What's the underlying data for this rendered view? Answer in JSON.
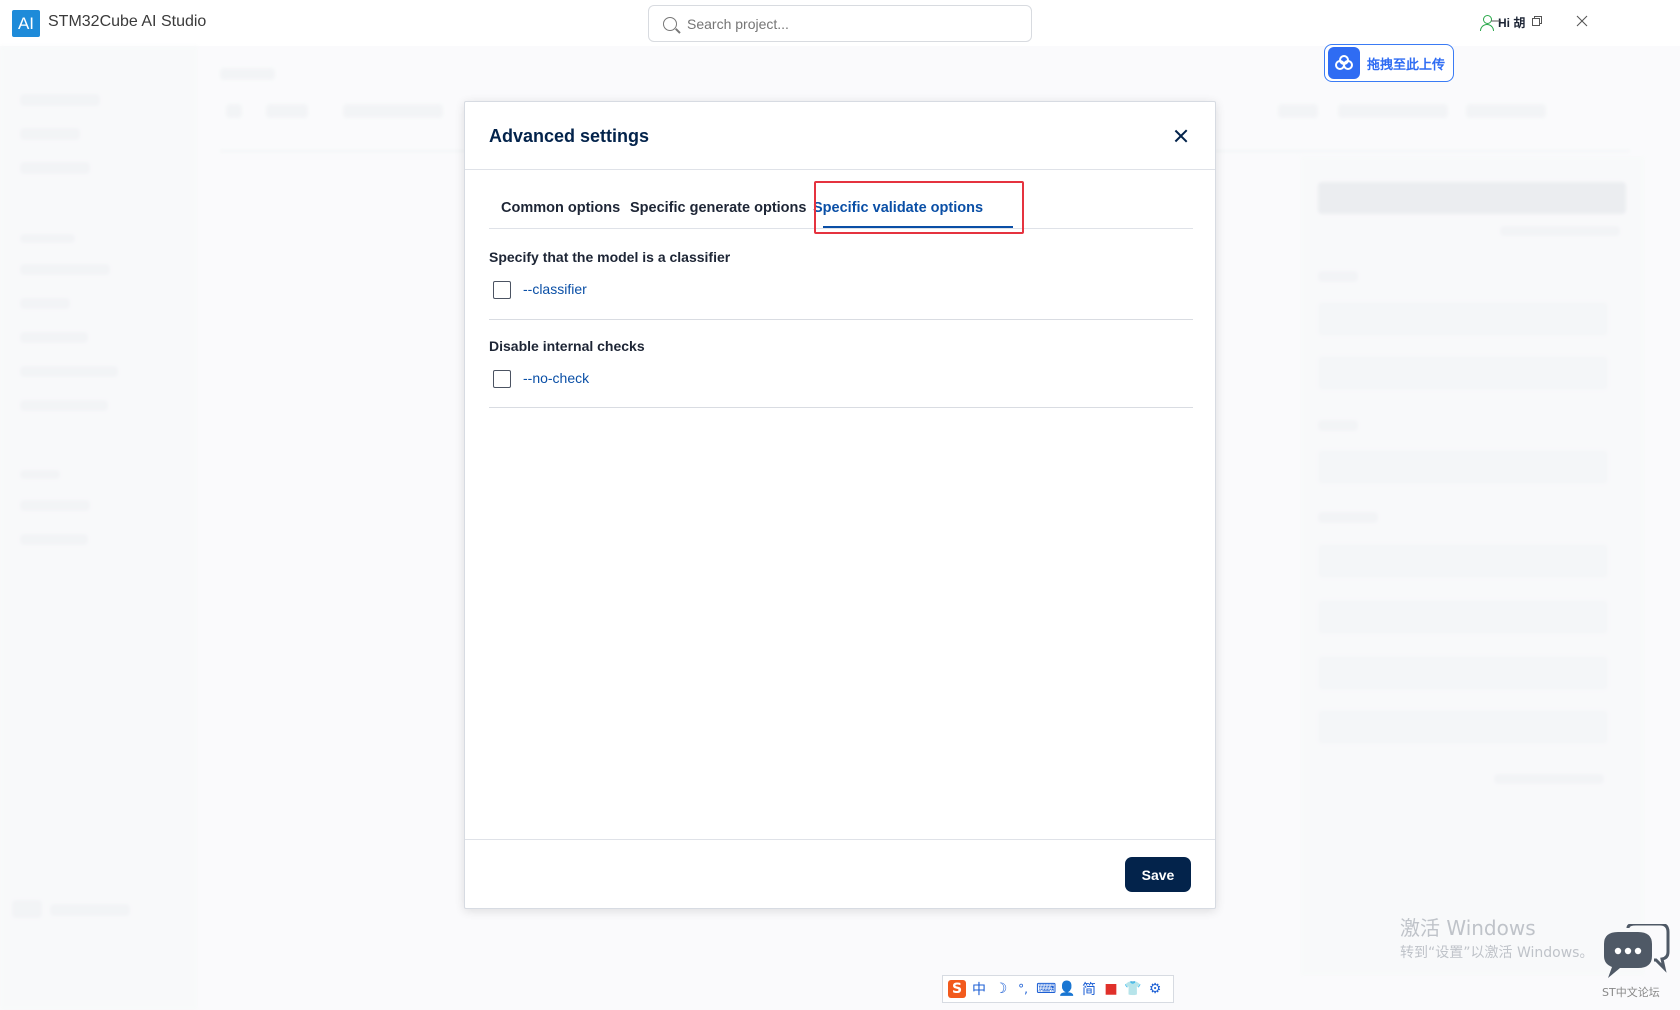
{
  "app": {
    "logo": "AI",
    "title": "STM32Cube AI Studio",
    "search_placeholder": "Search project...",
    "user_label": "Hi 胡",
    "window_controls": [
      "minimize-icon",
      "restore-icon",
      "close-icon"
    ]
  },
  "baidu_upload": {
    "icon": "cloud-icon",
    "label": "拖拽至此上传"
  },
  "modal": {
    "title": "Advanced settings",
    "tabs": [
      {
        "label": "Common options",
        "active": false
      },
      {
        "label": "Specific generate options",
        "active": false
      },
      {
        "label": "Specific validate options",
        "active": true
      }
    ],
    "sections": [
      {
        "title": "Specify that the model is a classifier",
        "option": "--classifier",
        "checked": false
      },
      {
        "title": "Disable internal checks",
        "option": "--no-check",
        "checked": false
      }
    ],
    "save_label": "Save"
  },
  "watermark": {
    "line1": "激活 Windows",
    "line2": "转到“设置”以激活 Windows。"
  },
  "forum": {
    "label": "ST中文论坛"
  },
  "ime": {
    "items": [
      "S",
      "中",
      "☽",
      "°,",
      "⌨",
      "👤",
      "简",
      "■",
      "👕",
      "⚙"
    ]
  },
  "colors": {
    "brand_navy": "#03234b",
    "link_blue": "#0a4fa6",
    "highlight_red": "#e5333f",
    "logo_blue": "#1e8bd9"
  }
}
